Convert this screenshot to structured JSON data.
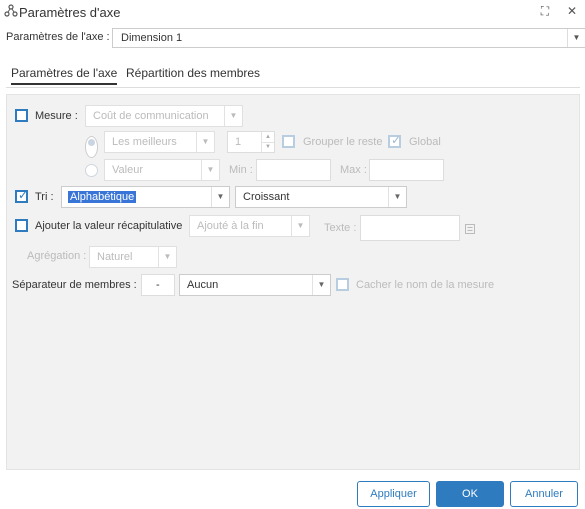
{
  "window": {
    "title": "Paramètres d'axe"
  },
  "axis": {
    "label": "Paramètres de l'axe :",
    "value": "Dimension 1"
  },
  "tabs": [
    {
      "label": "Paramètres de l'axe"
    },
    {
      "label": "Répartition des membres"
    }
  ],
  "measure": {
    "label": "Mesure :",
    "value": "Coût de communication",
    "checked": false,
    "top_mode": "Les meilleurs",
    "top_count": "1",
    "group_rest_label": "Grouper le reste",
    "global_label": "Global",
    "value_mode": "Valeur",
    "min_label": "Min :",
    "max_label": "Max :"
  },
  "sort": {
    "label": "Tri :",
    "checked": true,
    "value": "Alphabétique",
    "order": "Croissant"
  },
  "summary": {
    "label": "Ajouter la valeur récapitulative",
    "position": "Ajouté à la fin",
    "text_label": "Texte :"
  },
  "aggregation": {
    "label": "Agrégation :",
    "value": "Naturel"
  },
  "separator": {
    "label": "Séparateur de membres :",
    "value": "-",
    "type": "Aucun",
    "hide_measure_label": "Cacher le nom de la mesure"
  },
  "buttons": {
    "apply": "Appliquer",
    "ok": "OK",
    "cancel": "Annuler"
  },
  "icons": {
    "title": "axis-settings-icon",
    "expand": "expand-icon",
    "close": "close-icon",
    "dropdown": "chevron-down-icon",
    "edit": "edit-text-icon"
  },
  "glyphs": {
    "expand": "⛶",
    "close": "✕",
    "chevron": "▼",
    "spin_up": "▲",
    "spin_down": "▼",
    "check": "✓"
  },
  "colors": {
    "accent": "#2e7bbf",
    "selection": "#3875d7",
    "panel": "#f2f2f2"
  }
}
